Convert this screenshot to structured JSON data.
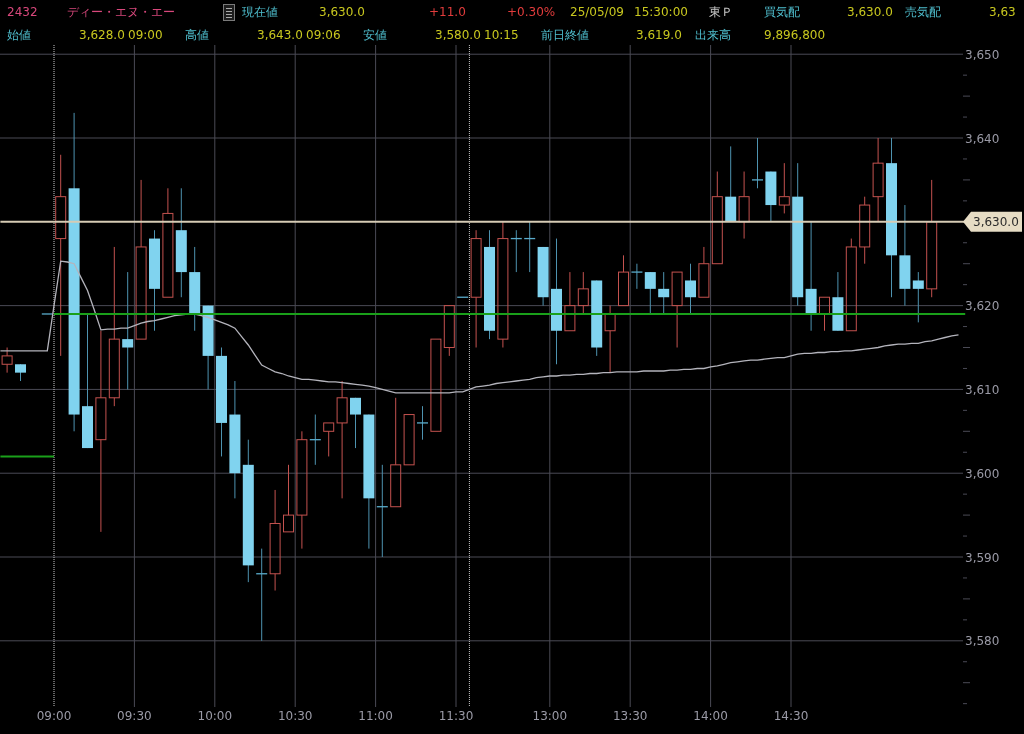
{
  "quote_bar": {
    "code": "2432",
    "name": "ディー・エヌ・エー",
    "last_price": {
      "label": "現在値",
      "value": "3,630.0"
    },
    "change": "+11.0",
    "change_percent": "+0.30%",
    "date": "25/05/09",
    "time": "15:30:00",
    "market": "東Ｐ",
    "bid": {
      "label": "買気配",
      "value": "3,630.0"
    },
    "ask": {
      "label": "売気配",
      "value": "3,63"
    }
  },
  "stats": [
    {
      "label": "始値",
      "value": "3,628.0",
      "time": "09:00"
    },
    {
      "label": "高値",
      "value": "3,643.0",
      "time": "09:06"
    },
    {
      "label": "安値",
      "value": "3,580.0",
      "time": "10:15"
    },
    {
      "label": "前日終値",
      "value": "3,619.0"
    },
    {
      "label": "出来高",
      "value": "9,896,800"
    }
  ],
  "chart": {
    "chart_data": {
      "type": "candlestick",
      "categories": [
        null,
        null,
        null,
        null,
        null,
        null,
        null,
        null,
        "09:00",
        null,
        null,
        null,
        null,
        null,
        null,
        null,
        null,
        null,
        null,
        null,
        "09:30",
        null,
        null,
        null,
        null,
        null,
        null,
        null,
        null,
        null,
        null,
        null,
        "10:00",
        null,
        null,
        null,
        null,
        null,
        null,
        null,
        null,
        null,
        null,
        null,
        "10:30",
        null,
        null,
        null,
        null,
        null,
        null,
        null,
        null,
        null,
        null,
        null,
        "11:00",
        null,
        null,
        null,
        null,
        null,
        null,
        null,
        null,
        null,
        null,
        null,
        "11:30",
        null,
        null,
        null,
        null,
        null,
        null,
        null,
        null,
        null,
        null,
        null,
        null,
        null,
        "13:00",
        null,
        null,
        null,
        null,
        null,
        null,
        null,
        null,
        null,
        null,
        null,
        "13:30",
        null,
        null,
        null,
        null,
        null,
        null,
        null,
        null,
        null,
        null,
        null,
        "14:00",
        null,
        null,
        null,
        null,
        null,
        null,
        null,
        null,
        null,
        null,
        null,
        "14:30",
        null,
        null,
        null,
        null,
        null,
        null,
        null,
        null,
        null,
        null,
        null,
        null,
        null,
        null,
        null,
        null,
        null,
        null,
        null,
        null,
        null,
        null,
        null,
        null,
        null,
        null
      ],
      "ohlc": [
        null,
        [
          3613,
          3615,
          3612,
          3614
        ],
        null,
        [
          3613,
          3613,
          3611,
          3612
        ],
        null,
        null,
        null,
        [
          3619,
          3619,
          3619,
          3619
        ],
        null,
        [
          3628,
          3638,
          3614,
          3633
        ],
        null,
        [
          3634,
          3643,
          3605,
          3607
        ],
        null,
        [
          3608,
          3619,
          3603,
          3603
        ],
        null,
        [
          3604,
          3617,
          3593,
          3609
        ],
        null,
        [
          3609,
          3627,
          3608,
          3616
        ],
        null,
        [
          3616,
          3624,
          3610,
          3615
        ],
        null,
        [
          3616,
          3635,
          3616,
          3627
        ],
        null,
        [
          3628,
          3629,
          3617,
          3622
        ],
        null,
        [
          3621,
          3634,
          3621,
          3631
        ],
        null,
        [
          3629,
          3634,
          3621,
          3624
        ],
        null,
        [
          3624,
          3627,
          3617,
          3619
        ],
        null,
        [
          3620,
          3620,
          3610,
          3614
        ],
        null,
        [
          3614,
          3615,
          3602,
          3606
        ],
        null,
        [
          3607,
          3611,
          3597,
          3600
        ],
        null,
        [
          3601,
          3604,
          3587,
          3589
        ],
        null,
        [
          3588,
          3591,
          3580,
          3588
        ],
        null,
        [
          3588,
          3598,
          3586,
          3594
        ],
        null,
        [
          3593,
          3601,
          3593,
          3595
        ],
        null,
        [
          3595,
          3605,
          3591,
          3604
        ],
        null,
        [
          3604,
          3607,
          3601,
          3604
        ],
        null,
        [
          3605,
          3606,
          3602,
          3606
        ],
        null,
        [
          3606,
          3611,
          3597,
          3609
        ],
        null,
        [
          3609,
          3609,
          3603,
          3607
        ],
        null,
        [
          3607,
          3607,
          3591,
          3597
        ],
        null,
        [
          3596,
          3601,
          3590,
          3596
        ],
        null,
        [
          3596,
          3609,
          3596,
          3601
        ],
        null,
        [
          3601,
          3607,
          3601,
          3607
        ],
        null,
        [
          3606,
          3608,
          3604,
          3606
        ],
        null,
        [
          3605,
          3616,
          3605,
          3616
        ],
        null,
        [
          3615,
          3620,
          3614,
          3620
        ],
        null,
        [
          3621,
          3621,
          3621,
          3621
        ],
        null,
        [
          3621,
          3629,
          3615,
          3628
        ],
        null,
        [
          3627,
          3629,
          3616,
          3617
        ],
        null,
        [
          3616,
          3630,
          3615,
          3628
        ],
        null,
        [
          3628,
          3629,
          3624,
          3628
        ],
        null,
        [
          3628,
          3630,
          3624,
          3628
        ],
        null,
        [
          3627,
          3627,
          3620,
          3621
        ],
        null,
        [
          3622,
          3628,
          3613,
          3617
        ],
        null,
        [
          3617,
          3624,
          3617,
          3620
        ],
        null,
        [
          3620,
          3624,
          3619,
          3622
        ],
        null,
        [
          3623,
          3623,
          3614,
          3615
        ],
        null,
        [
          3617,
          3620,
          3612,
          3619
        ],
        null,
        [
          3620,
          3626,
          3620,
          3624
        ],
        null,
        [
          3624,
          3625,
          3622,
          3624
        ],
        null,
        [
          3624,
          3624,
          3619,
          3622
        ],
        null,
        [
          3622,
          3624,
          3619,
          3621
        ],
        null,
        [
          3620,
          3624,
          3615,
          3624
        ],
        null,
        [
          3623,
          3625,
          3619,
          3621
        ],
        null,
        [
          3621,
          3627,
          3621,
          3625
        ],
        null,
        [
          3625,
          3636,
          3625,
          3633
        ],
        null,
        [
          3633,
          3639,
          3630,
          3630
        ],
        null,
        [
          3630,
          3636,
          3628,
          3633
        ],
        null,
        [
          3635,
          3640,
          3634,
          3635
        ],
        null,
        [
          3636,
          3636,
          3630,
          3632
        ],
        null,
        [
          3632,
          3637,
          3631,
          3633
        ],
        null,
        [
          3633,
          3637,
          3620,
          3621
        ],
        null,
        [
          3622,
          3630,
          3617,
          3619
        ],
        null,
        [
          3619,
          3621,
          3617,
          3621
        ],
        null,
        [
          3621,
          3624,
          3617,
          3617
        ],
        null,
        [
          3617,
          3628,
          3617,
          3627
        ],
        null,
        [
          3627,
          3633,
          3625,
          3632
        ],
        null,
        [
          3633,
          3640,
          3630,
          3637
        ],
        null,
        [
          3637,
          3640,
          3621,
          3626
        ],
        null,
        [
          3626,
          3632,
          3620,
          3622
        ],
        null,
        [
          3623,
          3624,
          3618,
          3622
        ],
        null,
        [
          3622,
          3635,
          3621,
          3630
        ],
        null,
        null,
        null,
        null,
        null
      ],
      "series": [
        {
          "type": "line",
          "color": "#b4b4bc",
          "values": [
            3614.6,
            3614.6,
            3614.6,
            3614.6,
            3614.6,
            3614.6,
            3614.6,
            3614.6,
            3620.0,
            3625.3,
            3625.2,
            3625.0,
            3623.4,
            3621.8,
            3619.5,
            3617.1,
            3617.2,
            3617.2,
            3617.3,
            3617.3,
            3617.6,
            3617.9,
            3618.1,
            3618.2,
            3618.4,
            3618.6,
            3618.8,
            3618.9,
            3619.0,
            3619.0,
            3618.8,
            3618.6,
            3618.3,
            3618.0,
            3617.7,
            3617.3,
            3616.3,
            3615.3,
            3614.1,
            3612.9,
            3612.5,
            3612.1,
            3611.9,
            3611.6,
            3611.4,
            3611.2,
            3611.2,
            3611.1,
            3611.0,
            3610.9,
            3610.9,
            3610.8,
            3610.7,
            3610.6,
            3610.5,
            3610.4,
            3610.2,
            3610.0,
            3609.8,
            3609.6,
            3609.6,
            3609.6,
            3609.6,
            3609.6,
            3609.6,
            3609.6,
            3609.6,
            3609.6,
            3609.7,
            3609.7,
            3610.0,
            3610.3,
            3610.4,
            3610.5,
            3610.7,
            3610.8,
            3610.9,
            3611.0,
            3611.1,
            3611.2,
            3611.4,
            3611.5,
            3611.6,
            3611.6,
            3611.7,
            3611.7,
            3611.8,
            3611.8,
            3611.9,
            3611.9,
            3612.0,
            3612.0,
            3612.1,
            3612.1,
            3612.1,
            3612.1,
            3612.2,
            3612.2,
            3612.2,
            3612.2,
            3612.3,
            3612.3,
            3612.4,
            3612.4,
            3612.5,
            3612.5,
            3612.7,
            3612.8,
            3613.0,
            3613.2,
            3613.3,
            3613.4,
            3613.5,
            3613.5,
            3613.6,
            3613.7,
            3613.8,
            3613.8,
            3614.0,
            3614.2,
            3614.3,
            3614.3,
            3614.4,
            3614.4,
            3614.5,
            3614.5,
            3614.6,
            3614.6,
            3614.7,
            3614.8,
            3614.9,
            3615.0,
            3615.2,
            3615.3,
            3615.4,
            3615.4,
            3615.5,
            3615.5,
            3615.7,
            3615.8,
            3616.0,
            3616.2,
            3616.4,
            3616.5,
            null
          ]
        },
        {
          "type": "line",
          "color": "#d6cbb4",
          "values": [
            3630,
            3630,
            3630,
            3630,
            3630,
            3630,
            3630,
            3630,
            3630,
            3630,
            3630,
            3630,
            3630,
            3630,
            3630,
            3630,
            3630,
            3630,
            3630,
            3630,
            3630,
            3630,
            3630,
            3630,
            3630,
            3630,
            3630,
            3630,
            3630,
            3630,
            3630,
            3630,
            3630,
            3630,
            3630,
            3630,
            3630,
            3630,
            3630,
            3630,
            3630,
            3630,
            3630,
            3630,
            3630,
            3630,
            3630,
            3630,
            3630,
            3630,
            3630,
            3630,
            3630,
            3630,
            3630,
            3630,
            3630,
            3630,
            3630,
            3630,
            3630,
            3630,
            3630,
            3630,
            3630,
            3630,
            3630,
            3630,
            3630,
            3630,
            3630,
            3630,
            3630,
            3630,
            3630,
            3630,
            3630,
            3630,
            3630,
            3630,
            3630,
            3630,
            3630,
            3630,
            3630,
            3630,
            3630,
            3630,
            3630,
            3630,
            3630,
            3630,
            3630,
            3630,
            3630,
            3630,
            3630,
            3630,
            3630,
            3630,
            3630,
            3630,
            3630,
            3630,
            3630,
            3630,
            3630,
            3630,
            3630,
            3630,
            3630,
            3630,
            3630,
            3630,
            3630,
            3630,
            3630,
            3630,
            3630,
            3630,
            3630,
            3630,
            3630,
            3630,
            3630,
            3630,
            3630,
            3630,
            3630,
            3630,
            3630,
            3630,
            3630,
            3630,
            3630,
            3630,
            3630,
            3630,
            3630,
            3630,
            3630,
            3630,
            3630,
            3630,
            3630
          ]
        },
        {
          "type": "line",
          "color": "#1aa01a",
          "values": [
            3602,
            3602,
            3602,
            3602,
            3602,
            3602,
            3602,
            3602,
            3602,
            null,
            null,
            null,
            null,
            null,
            null,
            null,
            null,
            null,
            null,
            null,
            null,
            null,
            null,
            null,
            null,
            null,
            null,
            null,
            null,
            null,
            null,
            null,
            null,
            null,
            null,
            null,
            null,
            null,
            null,
            null,
            null,
            null,
            null,
            null,
            null,
            null,
            null,
            null,
            null,
            null,
            null,
            null,
            null,
            null,
            null,
            null,
            null,
            null,
            null,
            null,
            null,
            null,
            null,
            null,
            null,
            null,
            null,
            null,
            null,
            null,
            null,
            null,
            null,
            null,
            null,
            null,
            null,
            null,
            null,
            null,
            null,
            null,
            null,
            null,
            null,
            null,
            null,
            null,
            null,
            null,
            null,
            null,
            null,
            null,
            null,
            null,
            null,
            null,
            null,
            null,
            null,
            null,
            null,
            null,
            null,
            null,
            null,
            null,
            null,
            null,
            null,
            null,
            null,
            null,
            null,
            null,
            null,
            null,
            null,
            null,
            null,
            null,
            null,
            null,
            null,
            null,
            null,
            null,
            null,
            null,
            null,
            null,
            null,
            null,
            null,
            null,
            null,
            null,
            null,
            null,
            null,
            null,
            null,
            null,
            null
          ]
        },
        {
          "type": "line",
          "color": "#1aa01a",
          "values": [
            null,
            null,
            null,
            null,
            null,
            null,
            null,
            null,
            3619,
            3619,
            3619,
            3619,
            3619,
            3619,
            3619,
            3619,
            3619,
            3619,
            3619,
            3619,
            3619,
            3619,
            3619,
            3619,
            3619,
            3619,
            3619,
            3619,
            3619,
            3619,
            3619,
            3619,
            3619,
            3619,
            3619,
            3619,
            3619,
            3619,
            3619,
            3619,
            3619,
            3619,
            3619,
            3619,
            3619,
            3619,
            3619,
            3619,
            3619,
            3619,
            3619,
            3619,
            3619,
            3619,
            3619,
            3619,
            3619,
            3619,
            3619,
            3619,
            3619,
            3619,
            3619,
            3619,
            3619,
            3619,
            3619,
            3619,
            3619,
            3619,
            3619,
            3619,
            3619,
            3619,
            3619,
            3619,
            3619,
            3619,
            3619,
            3619,
            3619,
            3619,
            3619,
            3619,
            3619,
            3619,
            3619,
            3619,
            3619,
            3619,
            3619,
            3619,
            3619,
            3619,
            3619,
            3619,
            3619,
            3619,
            3619,
            3619,
            3619,
            3619,
            3619,
            3619,
            3619,
            3619,
            3619,
            3619,
            3619,
            3619,
            3619,
            3619,
            3619,
            3619,
            3619,
            3619,
            3619,
            3619,
            3619,
            3619,
            3619,
            3619,
            3619,
            3619,
            3619,
            3619,
            3619,
            3619,
            3619,
            3619,
            3619,
            3619,
            3619,
            3619,
            3619,
            3619,
            3619,
            3619,
            3619,
            3619,
            3619,
            3619,
            3619,
            3619,
            3619
          ]
        }
      ],
      "ylim": [
        3572.1,
        3651.1
      ],
      "yticks": [
        {
          "value": 3650,
          "label": "3,650"
        },
        {
          "value": 3640,
          "label": "3,640"
        },
        {
          "value": 3620,
          "label": "3,620"
        },
        {
          "value": 3610,
          "label": "3,610"
        },
        {
          "value": 3600,
          "label": "3,600"
        },
        {
          "value": 3590,
          "label": "3,590"
        },
        {
          "value": 3580,
          "label": "3,580"
        }
      ],
      "grid": true
    },
    "last_price_tag": "3,630.0"
  }
}
